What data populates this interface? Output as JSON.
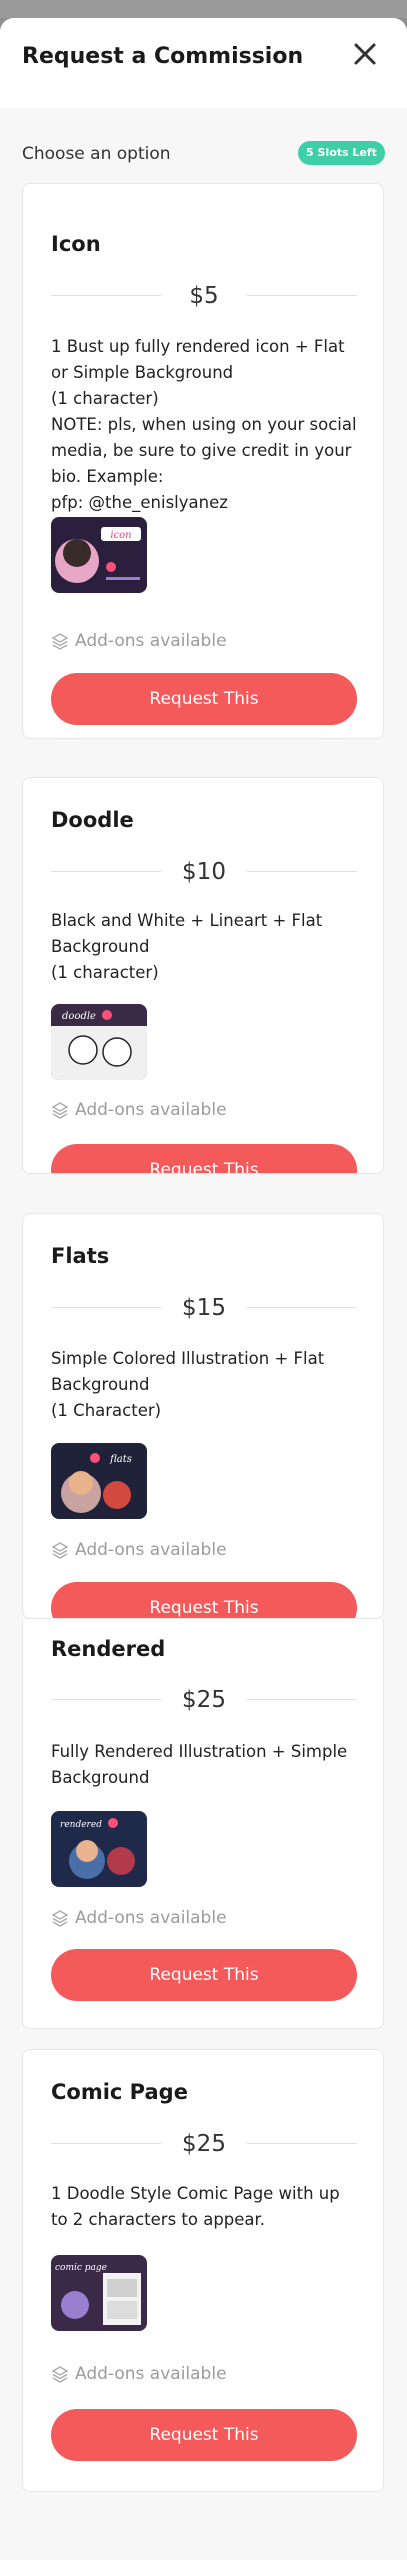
{
  "modal": {
    "title": "Request a Commission",
    "subhead": "Choose an option",
    "slots_badge": "5 Slots Left"
  },
  "colors": {
    "accent_button": "#f55a5a",
    "badge": "#3fcfa6"
  },
  "common": {
    "addons_label": "Add-ons available",
    "request_label": "Request This"
  },
  "options": [
    {
      "title": "Icon",
      "price": "$5",
      "description": "1 Bust up fully rendered icon + Flat or Simple Background\n(1 character)\nNOTE: pls, when using on your social media, be sure to give credit in your bio. Example:\npfp: @the_enislyanez",
      "thumb_text": "icon"
    },
    {
      "title": "Doodle",
      "price": "$10",
      "description": "Black and White + Lineart + Flat Background\n(1 character)",
      "thumb_text": "doodle"
    },
    {
      "title": "Flats",
      "price": "$15",
      "description": "Simple Colored Illustration + Flat Background\n(1 Character)",
      "thumb_text": "flats"
    },
    {
      "title": "Rendered",
      "price": "$25",
      "description": "Fully Rendered Illustration + Simple Background",
      "thumb_text": "rendered"
    },
    {
      "title": "Comic Page",
      "price": "$25",
      "description": "1 Doodle Style Comic Page with up to 2 characters to appear.",
      "thumb_text": "comic page"
    }
  ]
}
